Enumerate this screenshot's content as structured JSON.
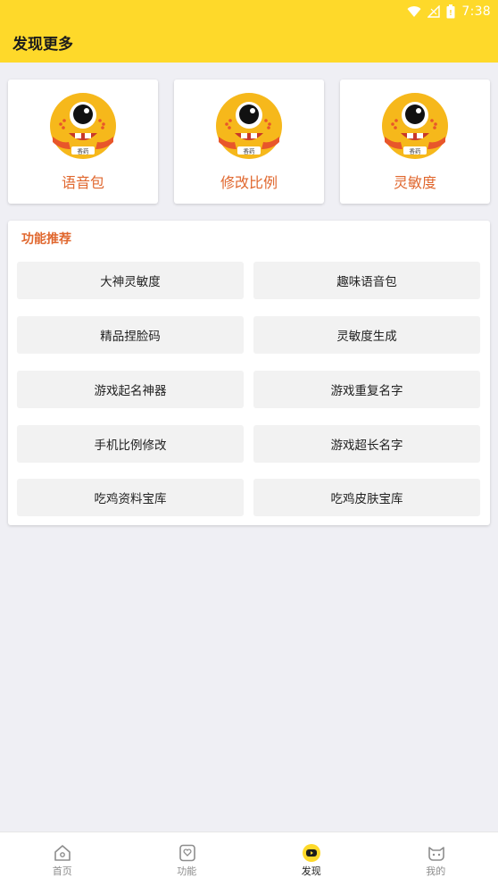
{
  "status_bar": {
    "time": "7:38"
  },
  "header": {
    "title": "发现更多"
  },
  "top_cards": [
    {
      "label": "语音包",
      "avatar_badge": "香药"
    },
    {
      "label": "修改比例",
      "avatar_badge": "香药"
    },
    {
      "label": "灵敏度",
      "avatar_badge": "香药"
    }
  ],
  "panel": {
    "title": "功能推荐",
    "items": [
      "大神灵敏度",
      "趣味语音包",
      "精品捏脸码",
      "灵敏度生成",
      "游戏起名神器",
      "游戏重复名字",
      "手机比例修改",
      "游戏超长名字",
      "吃鸡资料宝库",
      "吃鸡皮肤宝库"
    ]
  },
  "tabbar": {
    "active_index": 2,
    "tabs": [
      {
        "label": "首页",
        "icon": "home-icon"
      },
      {
        "label": "功能",
        "icon": "feature-heart-icon"
      },
      {
        "label": "发现",
        "icon": "discover-icon"
      },
      {
        "label": "我的",
        "icon": "cat-profile-icon"
      }
    ]
  },
  "colors": {
    "header": "#fed92a",
    "accent": "#e0672e",
    "background": "#efeff4",
    "button_bg": "#f2f2f2"
  }
}
